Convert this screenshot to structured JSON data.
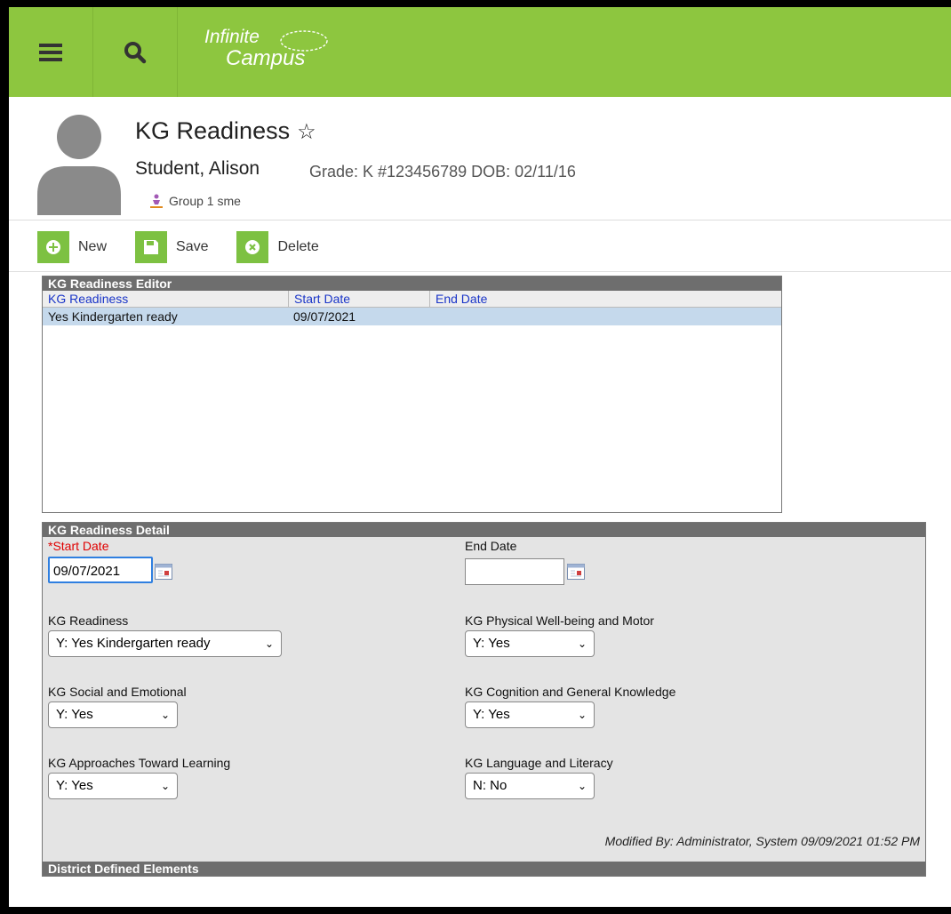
{
  "header": {
    "logo_line1": "Infinite",
    "logo_line2": "Campus",
    "brand_color": "#8dc63f"
  },
  "student": {
    "page_title": "KG Readiness",
    "name": "Student, Alison",
    "meta": "Grade: K #123456789 DOB: 02/11/16",
    "group": "Group 1 sme"
  },
  "toolbar": {
    "new_label": "New",
    "save_label": "Save",
    "delete_label": "Delete"
  },
  "editor": {
    "title": "KG Readiness Editor",
    "columns": [
      "KG Readiness",
      "Start Date",
      "End Date"
    ],
    "rows": [
      {
        "readiness": "Yes Kindergarten ready",
        "start": "09/07/2021",
        "end": ""
      }
    ]
  },
  "detail": {
    "title": "KG Readiness Detail",
    "start_date_label": "*Start Date",
    "start_date_value": "09/07/2021",
    "end_date_label": "End Date",
    "end_date_value": "",
    "kg_readiness_label": "KG Readiness",
    "kg_readiness_value": "Y: Yes Kindergarten ready",
    "physical_label": "KG Physical Well-being and Motor",
    "physical_value": "Y: Yes",
    "social_label": "KG Social and Emotional",
    "social_value": "Y: Yes",
    "cognition_label": "KG Cognition and General Knowledge",
    "cognition_value": "Y: Yes",
    "approaches_label": "KG Approaches Toward Learning",
    "approaches_value": "Y: Yes",
    "language_label": "KG Language and Literacy",
    "language_value": "N: No",
    "modified": "Modified By: Administrator, System 09/09/2021 01:52 PM",
    "district_header": "District Defined Elements"
  }
}
